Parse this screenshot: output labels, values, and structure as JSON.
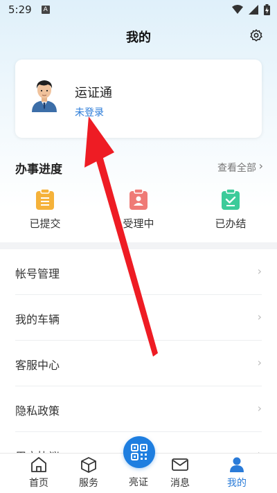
{
  "status_bar": {
    "time": "5:29",
    "notification_glyph": "A"
  },
  "header": {
    "title": "我的",
    "settings_icon": "gear-icon"
  },
  "profile": {
    "app_name": "运证通",
    "login_text": "未登录",
    "avatar_icon": "user-avatar-icon"
  },
  "progress": {
    "title": "办事进度",
    "view_all": "查看全部",
    "items": [
      {
        "label": "已提交",
        "icon": "submitted-icon",
        "color": "#f5b23a"
      },
      {
        "label": "受理中",
        "icon": "processing-icon",
        "color": "#ef7a76"
      },
      {
        "label": "已办结",
        "icon": "completed-icon",
        "color": "#3ccb9a"
      }
    ]
  },
  "menu": [
    {
      "label": "帐号管理"
    },
    {
      "label": "我的车辆"
    },
    {
      "label": "客服中心"
    },
    {
      "label": "隐私政策"
    },
    {
      "label": "用户协议"
    }
  ],
  "tabs": [
    {
      "label": "首页",
      "icon": "home-icon"
    },
    {
      "label": "服务",
      "icon": "cube-icon"
    },
    {
      "label": "亮证",
      "icon": "qr-code-icon"
    },
    {
      "label": "消息",
      "icon": "mail-icon"
    },
    {
      "label": "我的",
      "icon": "person-icon",
      "active": true
    }
  ],
  "colors": {
    "accent": "#2a7bd8",
    "arrow": "#ee1c24",
    "scan_button": "#1e7ee0"
  }
}
